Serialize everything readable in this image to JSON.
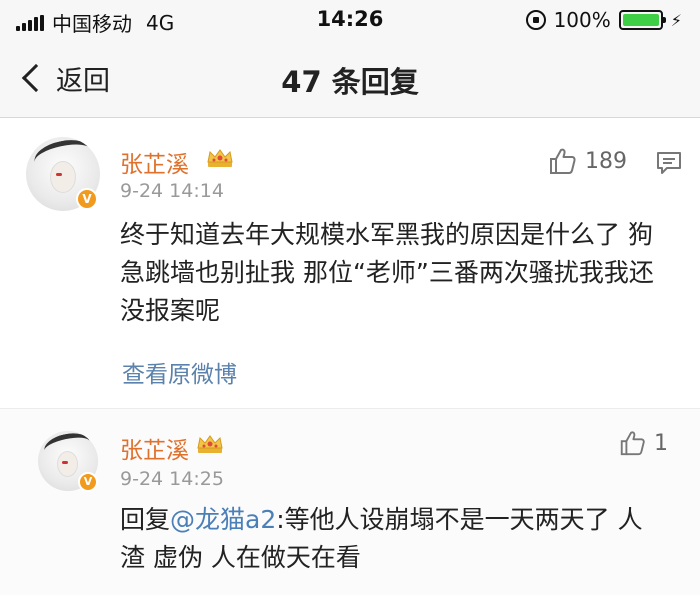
{
  "status": {
    "carrier": "中国移动",
    "network": "4G",
    "time": "14:26",
    "battery_percent_label": "100%",
    "battery_level": 1.0,
    "battery_color": "#3fcf47"
  },
  "nav": {
    "back_label": "返回",
    "title": "47 条回复"
  },
  "comments": [
    {
      "username": "张芷溪",
      "time": "9-24 14:14",
      "likes": "189",
      "text": "终于知道去年大规模水军黑我的原因是什么了 狗急跳墙也别扯我 那位“老师”三番两次骚扰我我还没报案呢",
      "view_original": "查看原微博"
    },
    {
      "username": "张芷溪",
      "time": "9-24 14:25",
      "likes": "1",
      "text_prefix": "回复",
      "mention": "@龙猫a2",
      "text_rest": ":等他人设崩塌不是一天两天了 人渣 虚伪 人在做天在看"
    }
  ],
  "colors": {
    "username": "#e0712c",
    "link": "#5b82ac",
    "mention": "#4a7fb8",
    "verify_badge": "#f29a1d",
    "crown": "#e8b130"
  },
  "icons": [
    "signal-icon",
    "orientation-lock-icon",
    "battery-icon",
    "charging-icon",
    "back-chevron-icon",
    "thumbs-up-icon",
    "comment-icon",
    "crown-icon",
    "verified-badge-icon"
  ]
}
